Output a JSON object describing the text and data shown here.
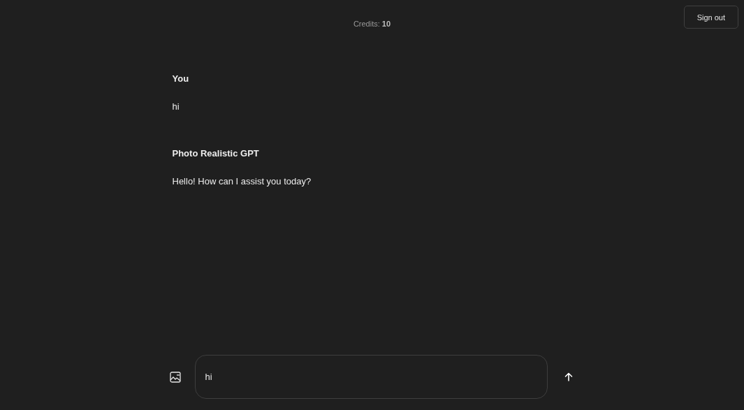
{
  "header": {
    "credits": "Credits: **10**",
    "sign_out": "Sign out"
  },
  "messages": [
    {
      "sender": "You",
      "text": "hi"
    },
    {
      "sender": "Photo Realistic GPT",
      "text": "Hello! How can I assist you today?"
    }
  ],
  "composer": {
    "value": "hi"
  }
}
